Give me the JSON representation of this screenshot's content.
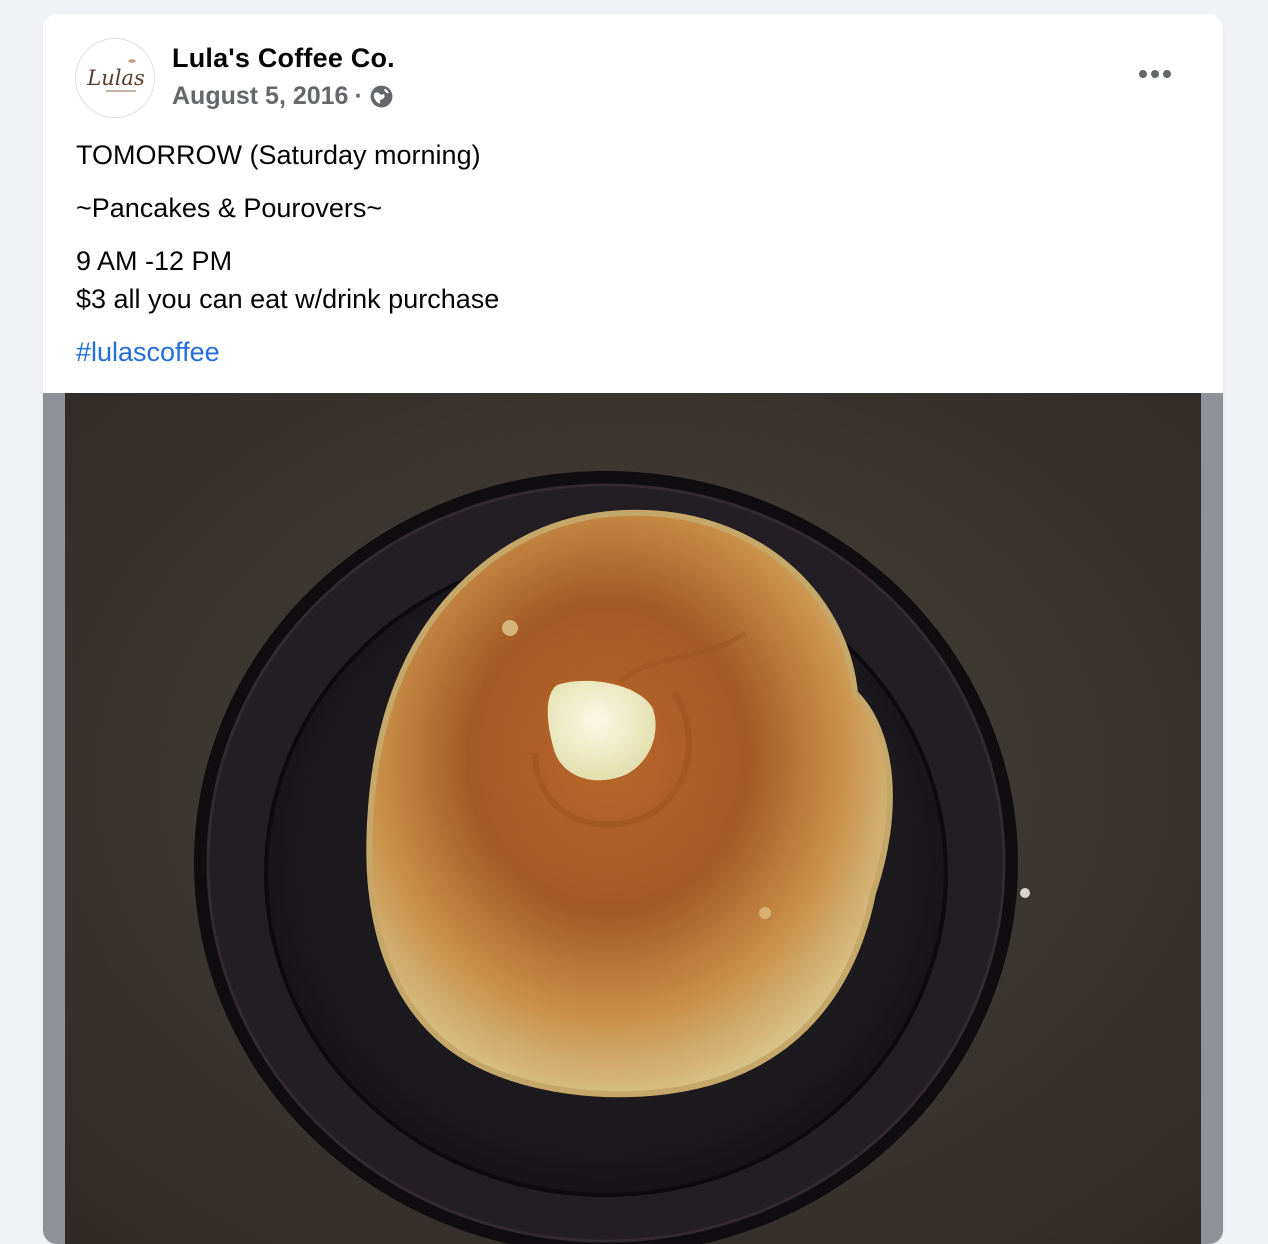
{
  "post": {
    "author": "Lula's Coffee Co.",
    "avatar_logo_text": "Lulas",
    "date": "August 5, 2016",
    "separator": "·",
    "privacy_icon": "globe-icon",
    "menu_icon": "more-options-icon",
    "lines": [
      "TOMORROW (Saturday morning)",
      "~Pancakes & Pourovers~",
      "9 AM -12 PM",
      "$3 all you can eat w/drink purchase"
    ],
    "hashtag": "#lulascoffee",
    "photo_subject": "pancake-on-plate-image"
  },
  "colors": {
    "page_bg": "#f0f2f5",
    "card_bg": "#ffffff",
    "name": "#050505",
    "meta": "#65676b",
    "link": "#216fdb",
    "media_bg": "#8e9197"
  }
}
